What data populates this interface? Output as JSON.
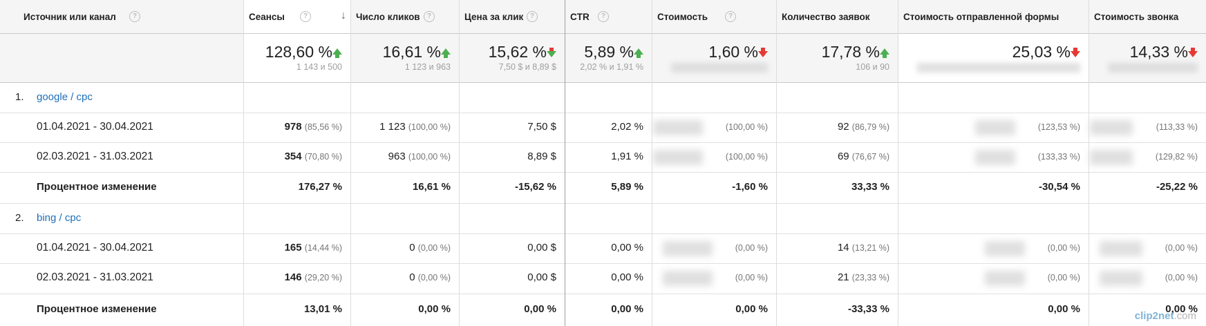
{
  "columns": [
    {
      "label": "Источник или канал"
    },
    {
      "label": "Сеансы"
    },
    {
      "label": "Число кликов"
    },
    {
      "label": "Цена за клик"
    },
    {
      "label": "CTR"
    },
    {
      "label": "Стоимость"
    },
    {
      "label": "Количество заявок"
    },
    {
      "label": "Стоимость отправленной формы"
    },
    {
      "label": "Стоимость звонка"
    }
  ],
  "totals": [
    {
      "value": "128,60 %",
      "sub": "1 143 и 500",
      "trend": "up"
    },
    {
      "value": "16,61 %",
      "sub": "1 123 и 963",
      "trend": "up"
    },
    {
      "value": "15,62 %",
      "sub": "7,50 $ и 8,89 $",
      "trend": "down-green"
    },
    {
      "value": "5,89 %",
      "sub": "2,02 % и 1,91 %",
      "trend": "up"
    },
    {
      "value": "1,60 %",
      "sub": "",
      "trend": "down"
    },
    {
      "value": "17,78 %",
      "sub": "106 и 90",
      "trend": "up"
    },
    {
      "value": "25,03 %",
      "sub": "",
      "trend": "down"
    },
    {
      "value": "14,33 %",
      "sub": "",
      "trend": "down"
    }
  ],
  "groups": [
    {
      "num": "1.",
      "name": "google / cpc",
      "rows": [
        {
          "label": "01.04.2021 - 30.04.2021",
          "cells": [
            {
              "v": "978",
              "p": "(85,56 %)"
            },
            {
              "v": "1 123",
              "p": "(100,00 %)"
            },
            {
              "v": "7,50 $",
              "p": ""
            },
            {
              "v": "2,02 %",
              "p": ""
            },
            {
              "v": "",
              "p": "(100,00 %)"
            },
            {
              "v": "92",
              "p": "(86,79 %)"
            },
            {
              "v": "",
              "p": "(123,53 %)"
            },
            {
              "v": "",
              "p": "(113,33 %)"
            }
          ]
        },
        {
          "label": "02.03.2021 - 31.03.2021",
          "cells": [
            {
              "v": "354",
              "p": "(70,80 %)"
            },
            {
              "v": "963",
              "p": "(100,00 %)"
            },
            {
              "v": "8,89 $",
              "p": ""
            },
            {
              "v": "1,91 %",
              "p": ""
            },
            {
              "v": "",
              "p": "(100,00 %)"
            },
            {
              "v": "69",
              "p": "(76,67 %)"
            },
            {
              "v": "",
              "p": "(133,33 %)"
            },
            {
              "v": "",
              "p": "(129,82 %)"
            }
          ]
        },
        {
          "label": "Процентное изменение",
          "cells": [
            {
              "v": "176,27 %"
            },
            {
              "v": "16,61 %"
            },
            {
              "v": "-15,62 %"
            },
            {
              "v": "5,89 %"
            },
            {
              "v": "-1,60 %"
            },
            {
              "v": "33,33 %"
            },
            {
              "v": "-30,54 %"
            },
            {
              "v": "-25,22 %"
            }
          ]
        }
      ]
    },
    {
      "num": "2.",
      "name": "bing / cpc",
      "rows": [
        {
          "label": "01.04.2021 - 30.04.2021",
          "cells": [
            {
              "v": "165",
              "p": "(14,44 %)"
            },
            {
              "v": "0",
              "p": "(0,00 %)"
            },
            {
              "v": "0,00 $",
              "p": ""
            },
            {
              "v": "0,00 %",
              "p": ""
            },
            {
              "v": "",
              "p": "(0,00 %)"
            },
            {
              "v": "14",
              "p": "(13,21 %)"
            },
            {
              "v": "",
              "p": "(0,00 %)"
            },
            {
              "v": "",
              "p": "(0,00 %)"
            }
          ]
        },
        {
          "label": "02.03.2021 - 31.03.2021",
          "cells": [
            {
              "v": "146",
              "p": "(29,20 %)"
            },
            {
              "v": "0",
              "p": "(0,00 %)"
            },
            {
              "v": "0,00 $",
              "p": ""
            },
            {
              "v": "0,00 %",
              "p": ""
            },
            {
              "v": "",
              "p": "(0,00 %)"
            },
            {
              "v": "21",
              "p": "(23,33 %)"
            },
            {
              "v": "",
              "p": "(0,00 %)"
            },
            {
              "v": "",
              "p": "(0,00 %)"
            }
          ]
        },
        {
          "label": "Процентное изменение",
          "cells": [
            {
              "v": "13,01 %"
            },
            {
              "v": "0,00 %"
            },
            {
              "v": "0,00 %"
            },
            {
              "v": "0,00 %"
            },
            {
              "v": "0,00 %"
            },
            {
              "v": "-33,33 %"
            },
            {
              "v": "0,00 %"
            },
            {
              "v": "0,00 %"
            }
          ]
        }
      ]
    }
  ],
  "watermark": {
    "brand": "clip2net",
    "suffix": ".com"
  },
  "colors": {
    "up": "#4caf50",
    "down": "#e53935",
    "link": "#1e6fb8"
  }
}
